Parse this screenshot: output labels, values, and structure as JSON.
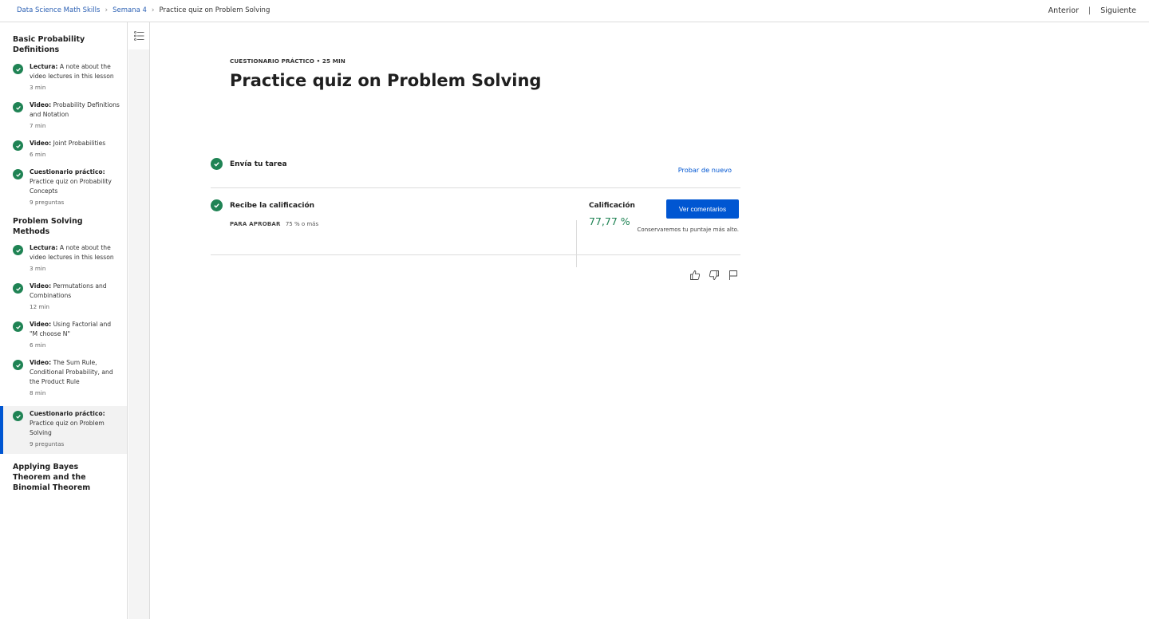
{
  "breadcrumb": {
    "course": "Data Science Math Skills",
    "week": "Semana 4",
    "current": "Practice quiz on Problem Solving"
  },
  "nav": {
    "previous": "Anterior",
    "separator": "|",
    "next": "Siguiente"
  },
  "sidebar": {
    "sections": [
      {
        "title": "Basic Probability Definitions",
        "items": [
          {
            "type": "Lectura:",
            "title": "A note about the video lectures in this lesson",
            "meta": "3 min"
          },
          {
            "type": "Video:",
            "title": "Probability Definitions and Notation",
            "meta": "7 min"
          },
          {
            "type": "Video:",
            "title": "Joint Probabilities",
            "meta": "6 min"
          },
          {
            "type": "Cuestionario práctico:",
            "title": "Practice quiz on Probability Concepts",
            "meta": "9 preguntas"
          }
        ]
      },
      {
        "title": "Problem Solving Methods",
        "items": [
          {
            "type": "Lectura:",
            "title": "A note about the video lectures in this lesson",
            "meta": "3 min"
          },
          {
            "type": "Video:",
            "title": "Permutations and Combinations",
            "meta": "12 min"
          },
          {
            "type": "Video:",
            "title": "Using Factorial and \"M choose N\"",
            "meta": "6 min"
          },
          {
            "type": "Video:",
            "title": "The Sum Rule, Conditional Probability, and the Product Rule",
            "meta": "8 min"
          },
          {
            "type": "Cuestionario práctico:",
            "title": "Practice quiz on Problem Solving",
            "meta": "9 preguntas"
          }
        ]
      },
      {
        "title": "Applying Bayes Theorem and the Binomial Theorem",
        "items": []
      }
    ]
  },
  "main": {
    "eyebrow": "CUESTIONARIO PRÁCTICO • 25 MIN",
    "title": "Practice quiz on Problem Solving",
    "step1": {
      "title": "Envía tu tarea",
      "action": "Probar de nuevo"
    },
    "step2": {
      "title": "Recibe la calificación",
      "pass_label": "PARA APROBAR",
      "pass_value": "75 % o más",
      "grade_label": "Calificación",
      "grade_value": "77,77 %",
      "feedback_button": "Ver comentarios",
      "keep_note": "Conservaremos tu puntaje más alto."
    }
  },
  "icons": [
    "list-icon",
    "check-icon",
    "thumbs-up-icon",
    "thumbs-down-icon",
    "flag-icon"
  ],
  "colors": {
    "accent": "#0056d2",
    "success": "#1f8354"
  }
}
